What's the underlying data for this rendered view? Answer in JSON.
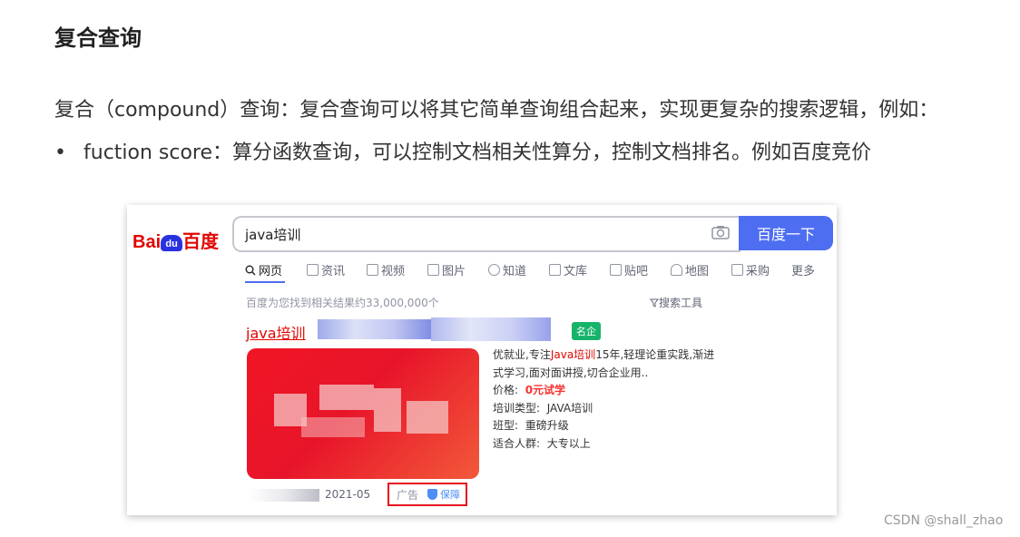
{
  "heading": "复合查询",
  "paragraph": "复合（compound）查询：复合查询可以将其它简单查询组合起来，实现更复杂的搜索逻辑，例如：",
  "bullet": {
    "marker": "•",
    "text": "fuction score：算分函数查询，可以控制文档相关性算分，控制文档排名。例如百度竞价"
  },
  "baidu": {
    "logo": {
      "part1": "Bai",
      "du": "du",
      "part2": "百度"
    },
    "search_value": "java培训",
    "search_button": "百度一下",
    "tabs": [
      {
        "label": "网页",
        "icon": "search-icon"
      },
      {
        "label": "资讯",
        "icon": "news-icon"
      },
      {
        "label": "视频",
        "icon": "video-icon"
      },
      {
        "label": "图片",
        "icon": "image-icon"
      },
      {
        "label": "知道",
        "icon": "question-icon"
      },
      {
        "label": "文库",
        "icon": "doc-icon"
      },
      {
        "label": "贴吧",
        "icon": "tieba-icon"
      },
      {
        "label": "地图",
        "icon": "map-icon"
      },
      {
        "label": "采购",
        "icon": "purchase-icon"
      },
      {
        "label": "更多",
        "icon": ""
      }
    ],
    "result_count": "百度为您找到相关结果约33,000,000个",
    "search_tools": "搜索工具",
    "ad": {
      "title": "java培训",
      "badge": "名企",
      "desc_line1_prefix": "优就业,专注",
      "desc_line1_highlight": "Java培训",
      "desc_line1_suffix": "15年,轻理论重实践,渐进",
      "desc_line2": "式学习,面对面讲授,切合企业用..",
      "price_label": "价格:",
      "price_value": "0元试学",
      "type_label": "培训类型:",
      "type_value": "JAVA培训",
      "class_label": "班型:",
      "class_value": "重磅升级",
      "audience_label": "适合人群:",
      "audience_value": "大专以上",
      "date": "2021-05",
      "ad_label": "广告",
      "guarantee": "保障"
    }
  },
  "watermark": "CSDN @shall_zhao"
}
